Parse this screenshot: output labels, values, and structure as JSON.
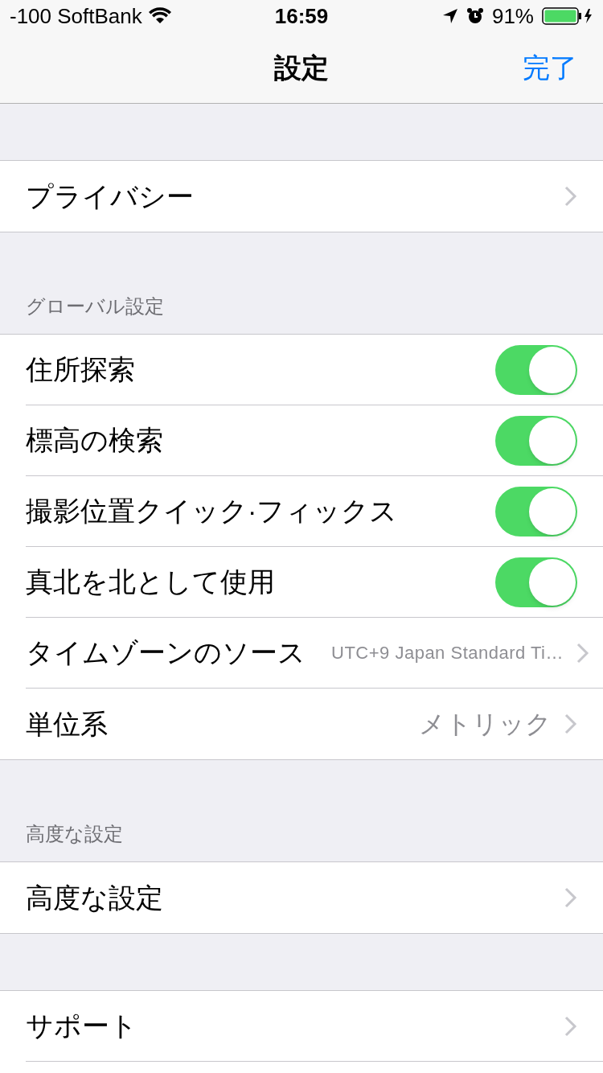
{
  "status_bar": {
    "carrier": "-100 SoftBank",
    "time": "16:59",
    "battery": "91%"
  },
  "nav": {
    "title": "設定",
    "done": "完了"
  },
  "sections": [
    {
      "rows": [
        {
          "kind": "link",
          "label": "プライバシー"
        }
      ]
    },
    {
      "header": "グローバル設定",
      "rows": [
        {
          "kind": "toggle",
          "label": "住所探索",
          "on": true
        },
        {
          "kind": "toggle",
          "label": "標高の検索",
          "on": true
        },
        {
          "kind": "toggle",
          "label": "撮影位置クイック·フィックス",
          "on": true
        },
        {
          "kind": "toggle",
          "label": "真北を北として使用",
          "on": true
        },
        {
          "kind": "link",
          "label": "タイムゾーンのソース",
          "value": "UTC+9 Japan Standard Ti…"
        },
        {
          "kind": "link",
          "label": "単位系",
          "value": "メトリック"
        }
      ]
    },
    {
      "header": "高度な設定",
      "rows": [
        {
          "kind": "link",
          "label": "高度な設定"
        }
      ]
    },
    {
      "rows": [
        {
          "kind": "link",
          "label": "サポート"
        }
      ]
    }
  ]
}
